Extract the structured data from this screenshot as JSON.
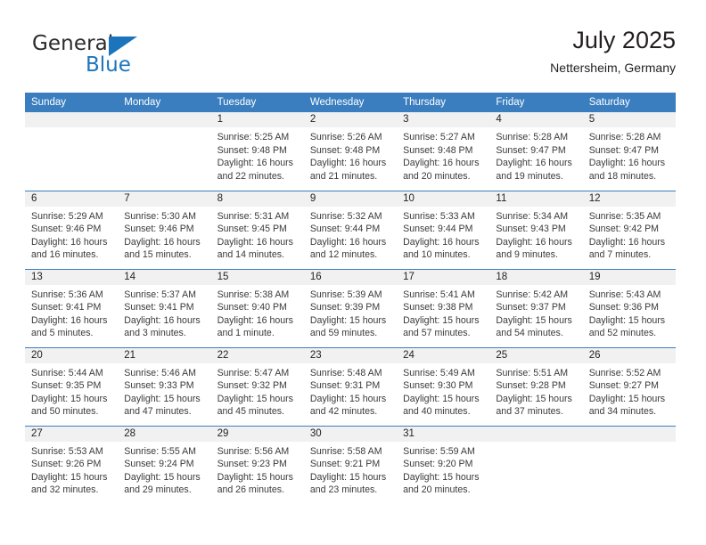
{
  "brand": {
    "word_one": "General",
    "word_two": "Blue",
    "triangle_color": "#1c75bc"
  },
  "header": {
    "title": "July 2025",
    "subtitle": "Nettersheim, Germany",
    "accent_color": "#3a7ebf",
    "daynum_band_color": "#f1f1f1"
  },
  "weekday_headers": [
    "Sunday",
    "Monday",
    "Tuesday",
    "Wednesday",
    "Thursday",
    "Friday",
    "Saturday"
  ],
  "weeks": [
    [
      {
        "day": "",
        "sunrise": "",
        "sunset": "",
        "daylight_1": "",
        "daylight_2": ""
      },
      {
        "day": "",
        "sunrise": "",
        "sunset": "",
        "daylight_1": "",
        "daylight_2": ""
      },
      {
        "day": "1",
        "sunrise": "Sunrise: 5:25 AM",
        "sunset": "Sunset: 9:48 PM",
        "daylight_1": "Daylight: 16 hours",
        "daylight_2": "and 22 minutes."
      },
      {
        "day": "2",
        "sunrise": "Sunrise: 5:26 AM",
        "sunset": "Sunset: 9:48 PM",
        "daylight_1": "Daylight: 16 hours",
        "daylight_2": "and 21 minutes."
      },
      {
        "day": "3",
        "sunrise": "Sunrise: 5:27 AM",
        "sunset": "Sunset: 9:48 PM",
        "daylight_1": "Daylight: 16 hours",
        "daylight_2": "and 20 minutes."
      },
      {
        "day": "4",
        "sunrise": "Sunrise: 5:28 AM",
        "sunset": "Sunset: 9:47 PM",
        "daylight_1": "Daylight: 16 hours",
        "daylight_2": "and 19 minutes."
      },
      {
        "day": "5",
        "sunrise": "Sunrise: 5:28 AM",
        "sunset": "Sunset: 9:47 PM",
        "daylight_1": "Daylight: 16 hours",
        "daylight_2": "and 18 minutes."
      }
    ],
    [
      {
        "day": "6",
        "sunrise": "Sunrise: 5:29 AM",
        "sunset": "Sunset: 9:46 PM",
        "daylight_1": "Daylight: 16 hours",
        "daylight_2": "and 16 minutes."
      },
      {
        "day": "7",
        "sunrise": "Sunrise: 5:30 AM",
        "sunset": "Sunset: 9:46 PM",
        "daylight_1": "Daylight: 16 hours",
        "daylight_2": "and 15 minutes."
      },
      {
        "day": "8",
        "sunrise": "Sunrise: 5:31 AM",
        "sunset": "Sunset: 9:45 PM",
        "daylight_1": "Daylight: 16 hours",
        "daylight_2": "and 14 minutes."
      },
      {
        "day": "9",
        "sunrise": "Sunrise: 5:32 AM",
        "sunset": "Sunset: 9:44 PM",
        "daylight_1": "Daylight: 16 hours",
        "daylight_2": "and 12 minutes."
      },
      {
        "day": "10",
        "sunrise": "Sunrise: 5:33 AM",
        "sunset": "Sunset: 9:44 PM",
        "daylight_1": "Daylight: 16 hours",
        "daylight_2": "and 10 minutes."
      },
      {
        "day": "11",
        "sunrise": "Sunrise: 5:34 AM",
        "sunset": "Sunset: 9:43 PM",
        "daylight_1": "Daylight: 16 hours",
        "daylight_2": "and 9 minutes."
      },
      {
        "day": "12",
        "sunrise": "Sunrise: 5:35 AM",
        "sunset": "Sunset: 9:42 PM",
        "daylight_1": "Daylight: 16 hours",
        "daylight_2": "and 7 minutes."
      }
    ],
    [
      {
        "day": "13",
        "sunrise": "Sunrise: 5:36 AM",
        "sunset": "Sunset: 9:41 PM",
        "daylight_1": "Daylight: 16 hours",
        "daylight_2": "and 5 minutes."
      },
      {
        "day": "14",
        "sunrise": "Sunrise: 5:37 AM",
        "sunset": "Sunset: 9:41 PM",
        "daylight_1": "Daylight: 16 hours",
        "daylight_2": "and 3 minutes."
      },
      {
        "day": "15",
        "sunrise": "Sunrise: 5:38 AM",
        "sunset": "Sunset: 9:40 PM",
        "daylight_1": "Daylight: 16 hours",
        "daylight_2": "and 1 minute."
      },
      {
        "day": "16",
        "sunrise": "Sunrise: 5:39 AM",
        "sunset": "Sunset: 9:39 PM",
        "daylight_1": "Daylight: 15 hours",
        "daylight_2": "and 59 minutes."
      },
      {
        "day": "17",
        "sunrise": "Sunrise: 5:41 AM",
        "sunset": "Sunset: 9:38 PM",
        "daylight_1": "Daylight: 15 hours",
        "daylight_2": "and 57 minutes."
      },
      {
        "day": "18",
        "sunrise": "Sunrise: 5:42 AM",
        "sunset": "Sunset: 9:37 PM",
        "daylight_1": "Daylight: 15 hours",
        "daylight_2": "and 54 minutes."
      },
      {
        "day": "19",
        "sunrise": "Sunrise: 5:43 AM",
        "sunset": "Sunset: 9:36 PM",
        "daylight_1": "Daylight: 15 hours",
        "daylight_2": "and 52 minutes."
      }
    ],
    [
      {
        "day": "20",
        "sunrise": "Sunrise: 5:44 AM",
        "sunset": "Sunset: 9:35 PM",
        "daylight_1": "Daylight: 15 hours",
        "daylight_2": "and 50 minutes."
      },
      {
        "day": "21",
        "sunrise": "Sunrise: 5:46 AM",
        "sunset": "Sunset: 9:33 PM",
        "daylight_1": "Daylight: 15 hours",
        "daylight_2": "and 47 minutes."
      },
      {
        "day": "22",
        "sunrise": "Sunrise: 5:47 AM",
        "sunset": "Sunset: 9:32 PM",
        "daylight_1": "Daylight: 15 hours",
        "daylight_2": "and 45 minutes."
      },
      {
        "day": "23",
        "sunrise": "Sunrise: 5:48 AM",
        "sunset": "Sunset: 9:31 PM",
        "daylight_1": "Daylight: 15 hours",
        "daylight_2": "and 42 minutes."
      },
      {
        "day": "24",
        "sunrise": "Sunrise: 5:49 AM",
        "sunset": "Sunset: 9:30 PM",
        "daylight_1": "Daylight: 15 hours",
        "daylight_2": "and 40 minutes."
      },
      {
        "day": "25",
        "sunrise": "Sunrise: 5:51 AM",
        "sunset": "Sunset: 9:28 PM",
        "daylight_1": "Daylight: 15 hours",
        "daylight_2": "and 37 minutes."
      },
      {
        "day": "26",
        "sunrise": "Sunrise: 5:52 AM",
        "sunset": "Sunset: 9:27 PM",
        "daylight_1": "Daylight: 15 hours",
        "daylight_2": "and 34 minutes."
      }
    ],
    [
      {
        "day": "27",
        "sunrise": "Sunrise: 5:53 AM",
        "sunset": "Sunset: 9:26 PM",
        "daylight_1": "Daylight: 15 hours",
        "daylight_2": "and 32 minutes."
      },
      {
        "day": "28",
        "sunrise": "Sunrise: 5:55 AM",
        "sunset": "Sunset: 9:24 PM",
        "daylight_1": "Daylight: 15 hours",
        "daylight_2": "and 29 minutes."
      },
      {
        "day": "29",
        "sunrise": "Sunrise: 5:56 AM",
        "sunset": "Sunset: 9:23 PM",
        "daylight_1": "Daylight: 15 hours",
        "daylight_2": "and 26 minutes."
      },
      {
        "day": "30",
        "sunrise": "Sunrise: 5:58 AM",
        "sunset": "Sunset: 9:21 PM",
        "daylight_1": "Daylight: 15 hours",
        "daylight_2": "and 23 minutes."
      },
      {
        "day": "31",
        "sunrise": "Sunrise: 5:59 AM",
        "sunset": "Sunset: 9:20 PM",
        "daylight_1": "Daylight: 15 hours",
        "daylight_2": "and 20 minutes."
      },
      {
        "day": "",
        "sunrise": "",
        "sunset": "",
        "daylight_1": "",
        "daylight_2": ""
      },
      {
        "day": "",
        "sunrise": "",
        "sunset": "",
        "daylight_1": "",
        "daylight_2": ""
      }
    ]
  ]
}
